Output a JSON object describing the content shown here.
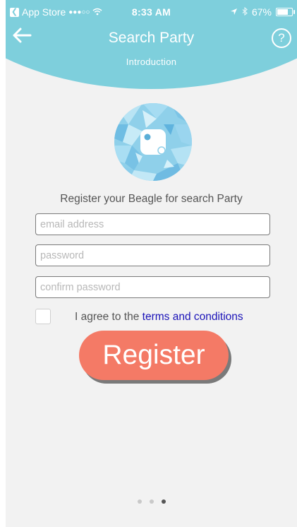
{
  "status_bar": {
    "back_app_label": "App Store",
    "signal": "●●●○○",
    "time": "8:33 AM",
    "battery_percent_text": "67%",
    "battery_level": 0.67
  },
  "nav": {
    "title": "Search Party",
    "subtitle": "Introduction",
    "help_label": "?"
  },
  "main": {
    "prompt": "Register your Beagle for search Party",
    "email_placeholder": "email address",
    "password_placeholder": "password",
    "confirm_placeholder": "confirm password",
    "agree_text": "I agree to the ",
    "terms_link": "terms and conditions",
    "register_label": "Register"
  },
  "pager": {
    "count": 3,
    "active_index": 2
  },
  "colors": {
    "header": "#7ecfdc",
    "background": "#f2f2f2",
    "register_button": "#f47a66",
    "link": "#1a12b8"
  }
}
